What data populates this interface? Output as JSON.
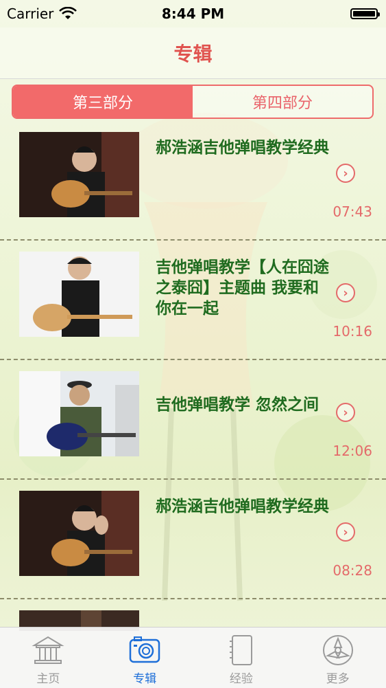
{
  "status_bar": {
    "carrier": "Carrier",
    "time": "8:44 PM",
    "battery_level": 1.0
  },
  "nav": {
    "title": "专辑"
  },
  "segment": {
    "items": [
      "第三部分",
      "第四部分"
    ],
    "selected": 0
  },
  "videos": [
    {
      "title": "郝浩涵吉他弹唱教学经典",
      "duration": "07:43"
    },
    {
      "title": "吉他弹唱教学【人在囧途之泰囧】主题曲 我要和你在一起",
      "duration": "10:16"
    },
    {
      "title": "吉他弹唱教学 忽然之间",
      "duration": "12:06"
    },
    {
      "title": "郝浩涵吉他弹唱教学经典",
      "duration": "08:28"
    }
  ],
  "tabs": [
    {
      "label": "主页",
      "icon": "home-icon"
    },
    {
      "label": "专辑",
      "icon": "camera-icon"
    },
    {
      "label": "经验",
      "icon": "notebook-icon"
    },
    {
      "label": "更多",
      "icon": "more-icon"
    }
  ],
  "colors": {
    "accent": "#f26a6a",
    "title_green": "#1f6b1f",
    "tab_active": "#1e6fd8"
  }
}
